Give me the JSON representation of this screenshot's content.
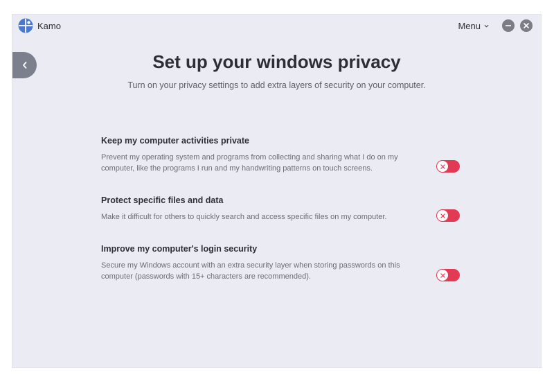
{
  "app": {
    "name": "Kamo",
    "menu_label": "Menu"
  },
  "page": {
    "title": "Set up your windows privacy",
    "subtitle": "Turn on your privacy settings to add extra layers of security on your computer."
  },
  "settings": [
    {
      "title": "Keep my computer activities private",
      "description": "Prevent my operating system and programs from collecting and sharing what I do on my computer, like the programs I run and my handwriting patterns on touch screens.",
      "enabled": false
    },
    {
      "title": "Protect specific files and data",
      "description": "Make it difficult for others to quickly search and access specific files on my computer.",
      "enabled": false
    },
    {
      "title": "Improve my computer's login security",
      "description": "Secure my Windows account with an extra security layer when storing passwords on this computer (passwords with 15+ characters are recommended).",
      "enabled": false
    }
  ],
  "colors": {
    "background": "#ebebf3",
    "toggle_off": "#e23a54",
    "logo": "#4a7ad0",
    "title_text": "#2e2f36"
  },
  "icons": {
    "logo": "kamo-logo-icon",
    "menu_chevron": "chevron-down-icon",
    "minimize": "minimize-icon",
    "close": "close-icon",
    "back": "chevron-left-icon",
    "toggle_knob": "x-icon"
  }
}
